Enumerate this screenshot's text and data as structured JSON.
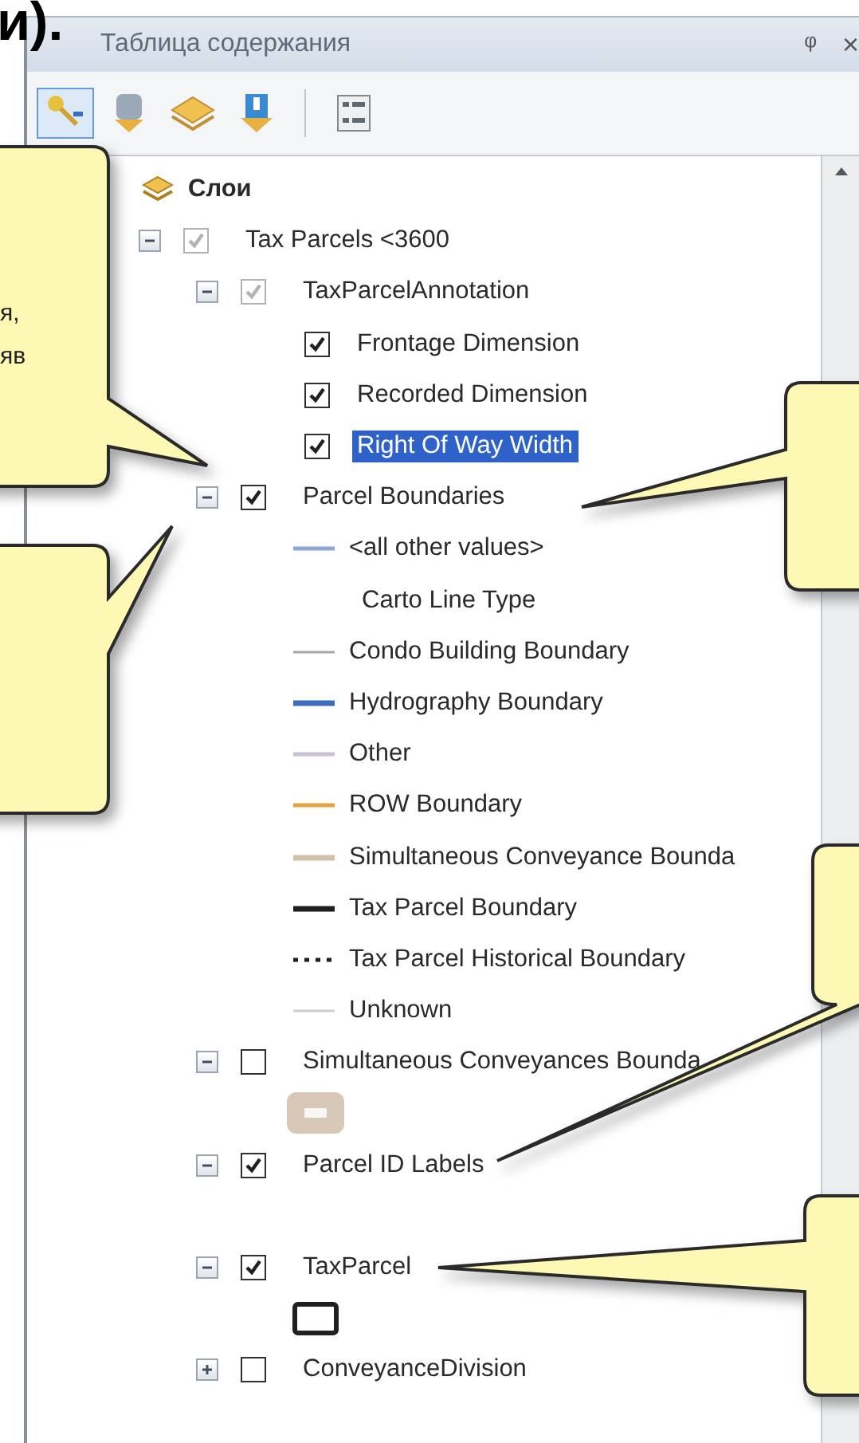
{
  "heading": "и).",
  "panel": {
    "title": "Таблица содержания",
    "pin": "ᵠ",
    "close": "×",
    "toolbar": [
      {
        "kind": "drawing",
        "selected": true
      },
      {
        "kind": "source",
        "selected": false
      },
      {
        "kind": "visibility",
        "selected": false
      },
      {
        "kind": "selection",
        "selected": false
      },
      {
        "kind": "options",
        "selected": false
      }
    ],
    "tree": [
      {
        "kind": "frame",
        "label": "Слои",
        "children": [
          {
            "kind": "layer",
            "label": "Tax Parcels <3600",
            "checked": true,
            "disabled": true,
            "expanded": true,
            "children": [
              {
                "kind": "layer",
                "label": "TaxParcelAnnotation",
                "checked": true,
                "disabled": true,
                "expanded": true,
                "children": [
                  {
                    "kind": "class",
                    "label": "Frontage Dimension",
                    "checked": true,
                    "selected": false
                  },
                  {
                    "kind": "class",
                    "label": "Recorded Dimension",
                    "checked": true,
                    "selected": false
                  },
                  {
                    "kind": "class",
                    "label": "Right Of Way Width",
                    "checked": true,
                    "selected": true
                  }
                ]
              },
              {
                "kind": "layer",
                "label": "Parcel Boundaries",
                "checked": true,
                "disabled": false,
                "expanded": true,
                "children": [
                  {
                    "kind": "legend",
                    "label": "<all other values>",
                    "color": "#8fa8d8"
                  },
                  {
                    "kind": "heading",
                    "label": "Carto Line Type"
                  },
                  {
                    "kind": "legend",
                    "label": "Condo Building Boundary",
                    "color": "#a8a8a8"
                  },
                  {
                    "kind": "legend",
                    "label": "Hydrography Boundary",
                    "color": "#3c6cc0"
                  },
                  {
                    "kind": "legend",
                    "label": "Other",
                    "color": "#c8c0d8"
                  },
                  {
                    "kind": "legend",
                    "label": "ROW Boundary",
                    "color": "#e8a040"
                  },
                  {
                    "kind": "legend",
                    "label": "Simultaneous Conveyance Bounda",
                    "color": "#d0c0a8"
                  },
                  {
                    "kind": "legend",
                    "label": "Tax Parcel Boundary",
                    "color": "#202020"
                  },
                  {
                    "kind": "legend",
                    "label": "Tax Parcel Historical Boundary",
                    "color": "#202020"
                  },
                  {
                    "kind": "legend",
                    "label": "Unknown",
                    "color": "#d0d0d0"
                  }
                ]
              },
              {
                "kind": "layer",
                "label": "Simultaneous Conveyances Bounda",
                "checked": false,
                "disabled": false,
                "expanded": true,
                "children": [
                  {
                    "kind": "fill",
                    "color": "#d8c8b8"
                  }
                ]
              },
              {
                "kind": "layer",
                "label": "Parcel ID Labels",
                "checked": true,
                "disabled": false,
                "expanded": true
              },
              {
                "kind": "layer",
                "label": "TaxParcel",
                "checked": true,
                "disabled": false,
                "expanded": true,
                "children": [
                  {
                    "kind": "outline",
                    "color": "#202020"
                  }
                ]
              },
              {
                "kind": "layer",
                "label": "ConveyanceDivision",
                "checked": false,
                "disabled": false,
                "expanded": false
              }
            ]
          }
        ]
      }
    ]
  },
  "callouts": [
    {
      "kind": "callout",
      "lines": [
        "я,",
        "яв"
      ]
    },
    {
      "kind": "callout"
    },
    {
      "kind": "callout"
    },
    {
      "kind": "callout"
    },
    {
      "kind": "callout"
    }
  ]
}
